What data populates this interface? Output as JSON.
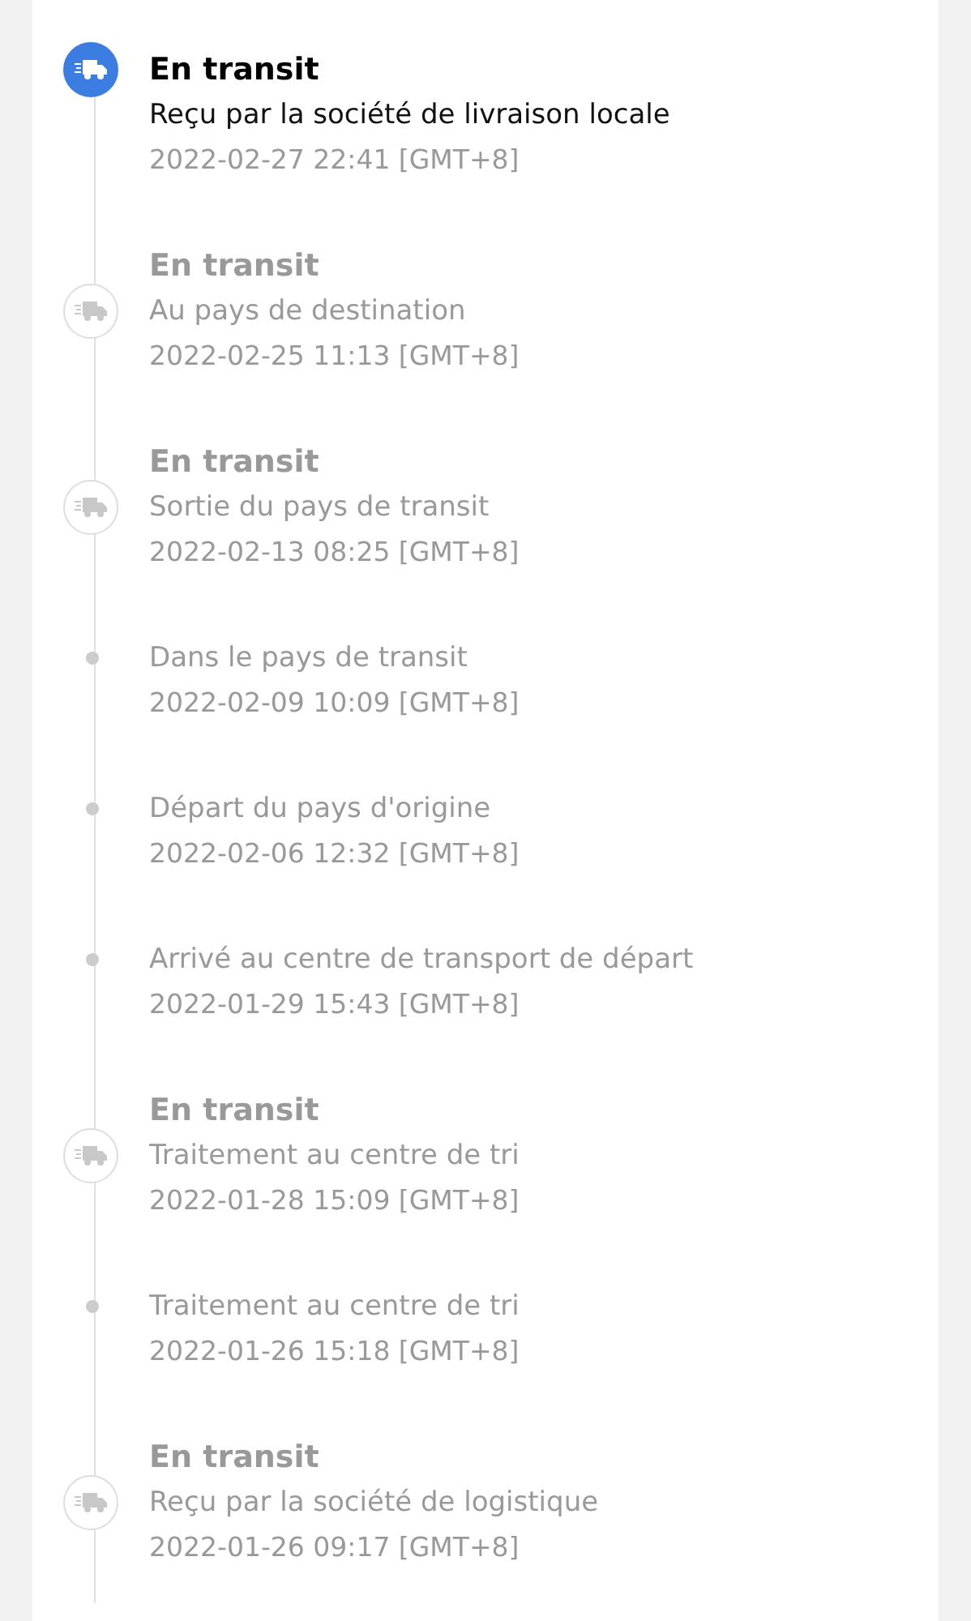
{
  "events": [
    {
      "kind": "status",
      "current": true,
      "title": "En transit",
      "description": "Reçu par la société de livraison locale",
      "time": "2022-02-27 22:41 [GMT+8]"
    },
    {
      "kind": "status",
      "current": false,
      "title": "En transit",
      "description": "Au pays de destination",
      "time": "2022-02-25 11:13 [GMT+8]"
    },
    {
      "kind": "status",
      "current": false,
      "title": "En transit",
      "description": "Sortie du pays de transit",
      "time": "2022-02-13 08:25 [GMT+8]"
    },
    {
      "kind": "step",
      "current": false,
      "description": "Dans le pays de transit",
      "time": "2022-02-09 10:09 [GMT+8]"
    },
    {
      "kind": "step",
      "current": false,
      "description": "Départ du pays d'origine",
      "time": "2022-02-06 12:32 [GMT+8]"
    },
    {
      "kind": "step",
      "current": false,
      "description": "Arrivé au centre de transport de départ",
      "time": "2022-01-29 15:43 [GMT+8]"
    },
    {
      "kind": "status",
      "current": false,
      "title": "En transit",
      "description": "Traitement au centre de tri",
      "time": "2022-01-28 15:09 [GMT+8]"
    },
    {
      "kind": "step",
      "current": false,
      "description": "Traitement au centre de tri",
      "time": "2022-01-26 15:18 [GMT+8]"
    },
    {
      "kind": "status",
      "current": false,
      "title": "En transit",
      "description": "Reçu par la société de logistique",
      "time": "2022-01-26 09:17 [GMT+8]"
    }
  ]
}
